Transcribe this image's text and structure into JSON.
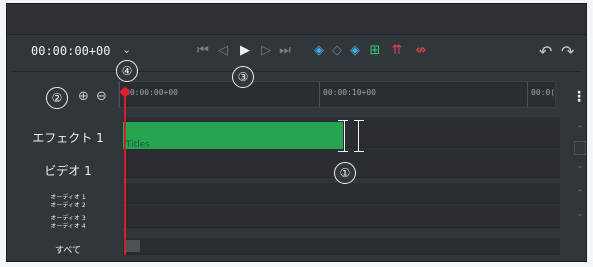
{
  "transport": {
    "timecode": "00:00:00+00",
    "timecode_menu_icon": "chevron-down-icon"
  },
  "ruler": {
    "ticks": [
      "00:00:00+00",
      "00:00:10+00",
      "00:0("
    ]
  },
  "tracks": {
    "effects_label": "エフェクト 1",
    "video_label": "ビデオ 1",
    "audio_labels": [
      "オーディオ 1",
      "オーディオ 2",
      "オーディオ 3",
      "オーディオ 4"
    ],
    "all_label": "すべて",
    "clip_label": "Titles"
  },
  "callouts": {
    "one": "①",
    "two": "②",
    "three": "③",
    "four": "④"
  },
  "colors": {
    "panel": "#31363b",
    "clip_green": "#27a452",
    "playhead": "#d0202b",
    "accent_blue": "#3daee9"
  }
}
